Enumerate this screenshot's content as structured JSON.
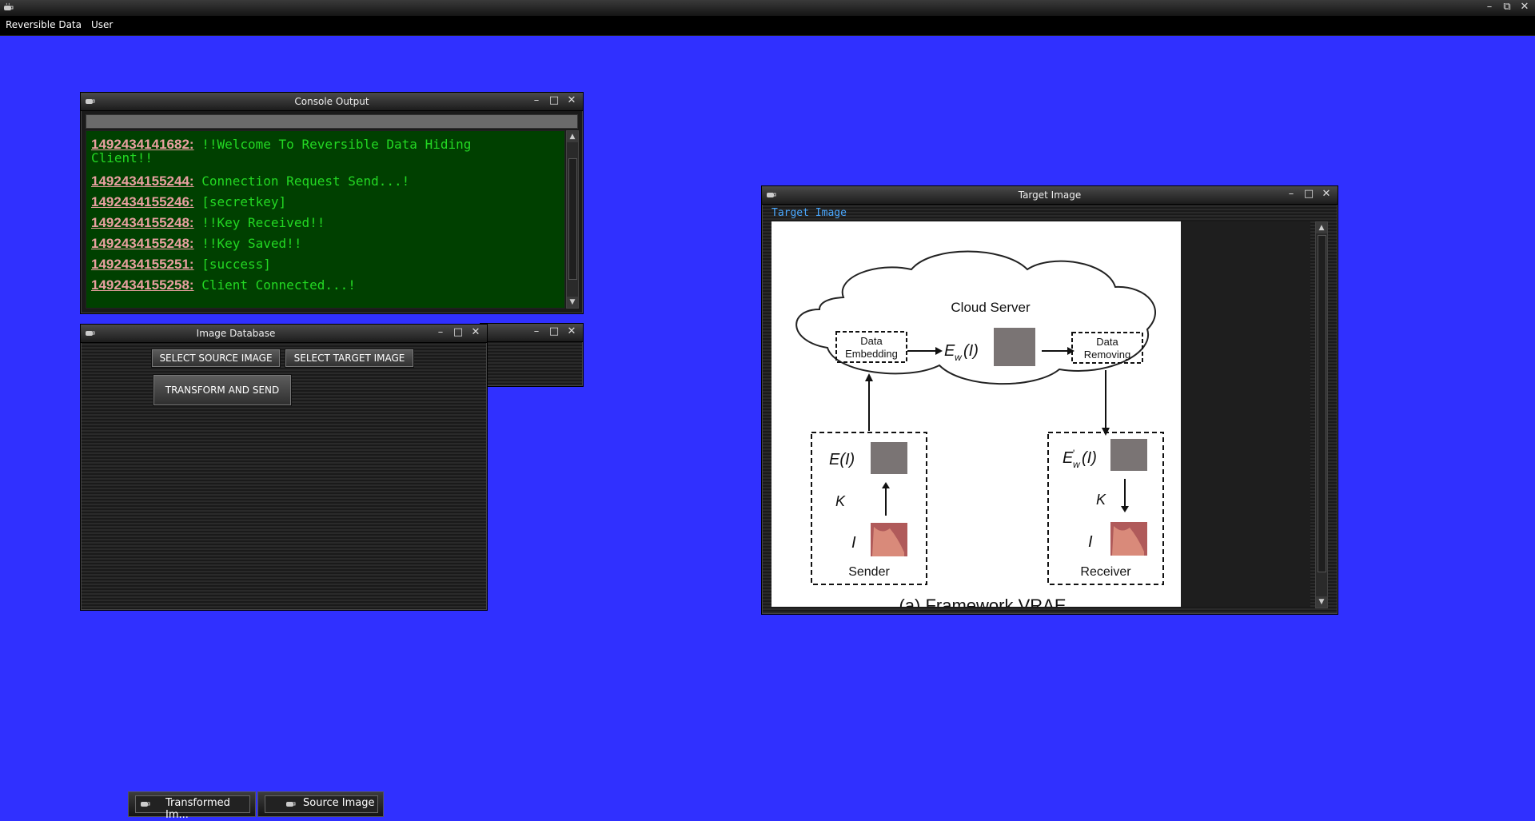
{
  "menubar": {
    "items": [
      "Reversible Data",
      "User"
    ]
  },
  "window_controls": {
    "minimize": "–",
    "maximize": "□",
    "close": "✕"
  },
  "console": {
    "title": "Console Output",
    "lines": [
      {
        "ts": "1492434141682:",
        "msg": "!!Welcome To Reversible Data Hiding"
      },
      {
        "ts": "",
        "msg": "Client!!"
      },
      {
        "ts": "1492434155244:",
        "msg": "Connection Request Send...!"
      },
      {
        "ts": "1492434155246:",
        "msg": "[secretkey]"
      },
      {
        "ts": "1492434155248:",
        "msg": "!!Key Received!!"
      },
      {
        "ts": "1492434155248:",
        "msg": "!!Key Saved!!"
      },
      {
        "ts": "1492434155251:",
        "msg": "[success]"
      },
      {
        "ts": "1492434155258:",
        "msg": "Client Connected...!"
      }
    ]
  },
  "image_database": {
    "title": "Image Database",
    "buttons": {
      "select_source": "SELECT SOURCE IMAGE",
      "select_target": "SELECT TARGET IMAGE",
      "transform_send": "TRANSFORM AND SEND"
    }
  },
  "target_image": {
    "title": "Target Image",
    "label": "Target Image",
    "figure": {
      "cloud": "Cloud Server",
      "data_embedding": [
        "Data",
        "Embedding"
      ],
      "data_removing": [
        "Data",
        "Removing"
      ],
      "ew_i": "E",
      "ew_sub": "w",
      "ew_paren": "(I)",
      "ei": "E(I)",
      "ewp": "E",
      "ewp_sup": "'",
      "ewp_sub": "w",
      "ewp_paren": "(I)",
      "k": "K",
      "i": "I",
      "sender": "Sender",
      "receiver": "Receiver",
      "caption": "(a) Framework VRAE"
    }
  },
  "taskbar": {
    "items": [
      "Transformed Im...",
      "Source Image"
    ]
  }
}
